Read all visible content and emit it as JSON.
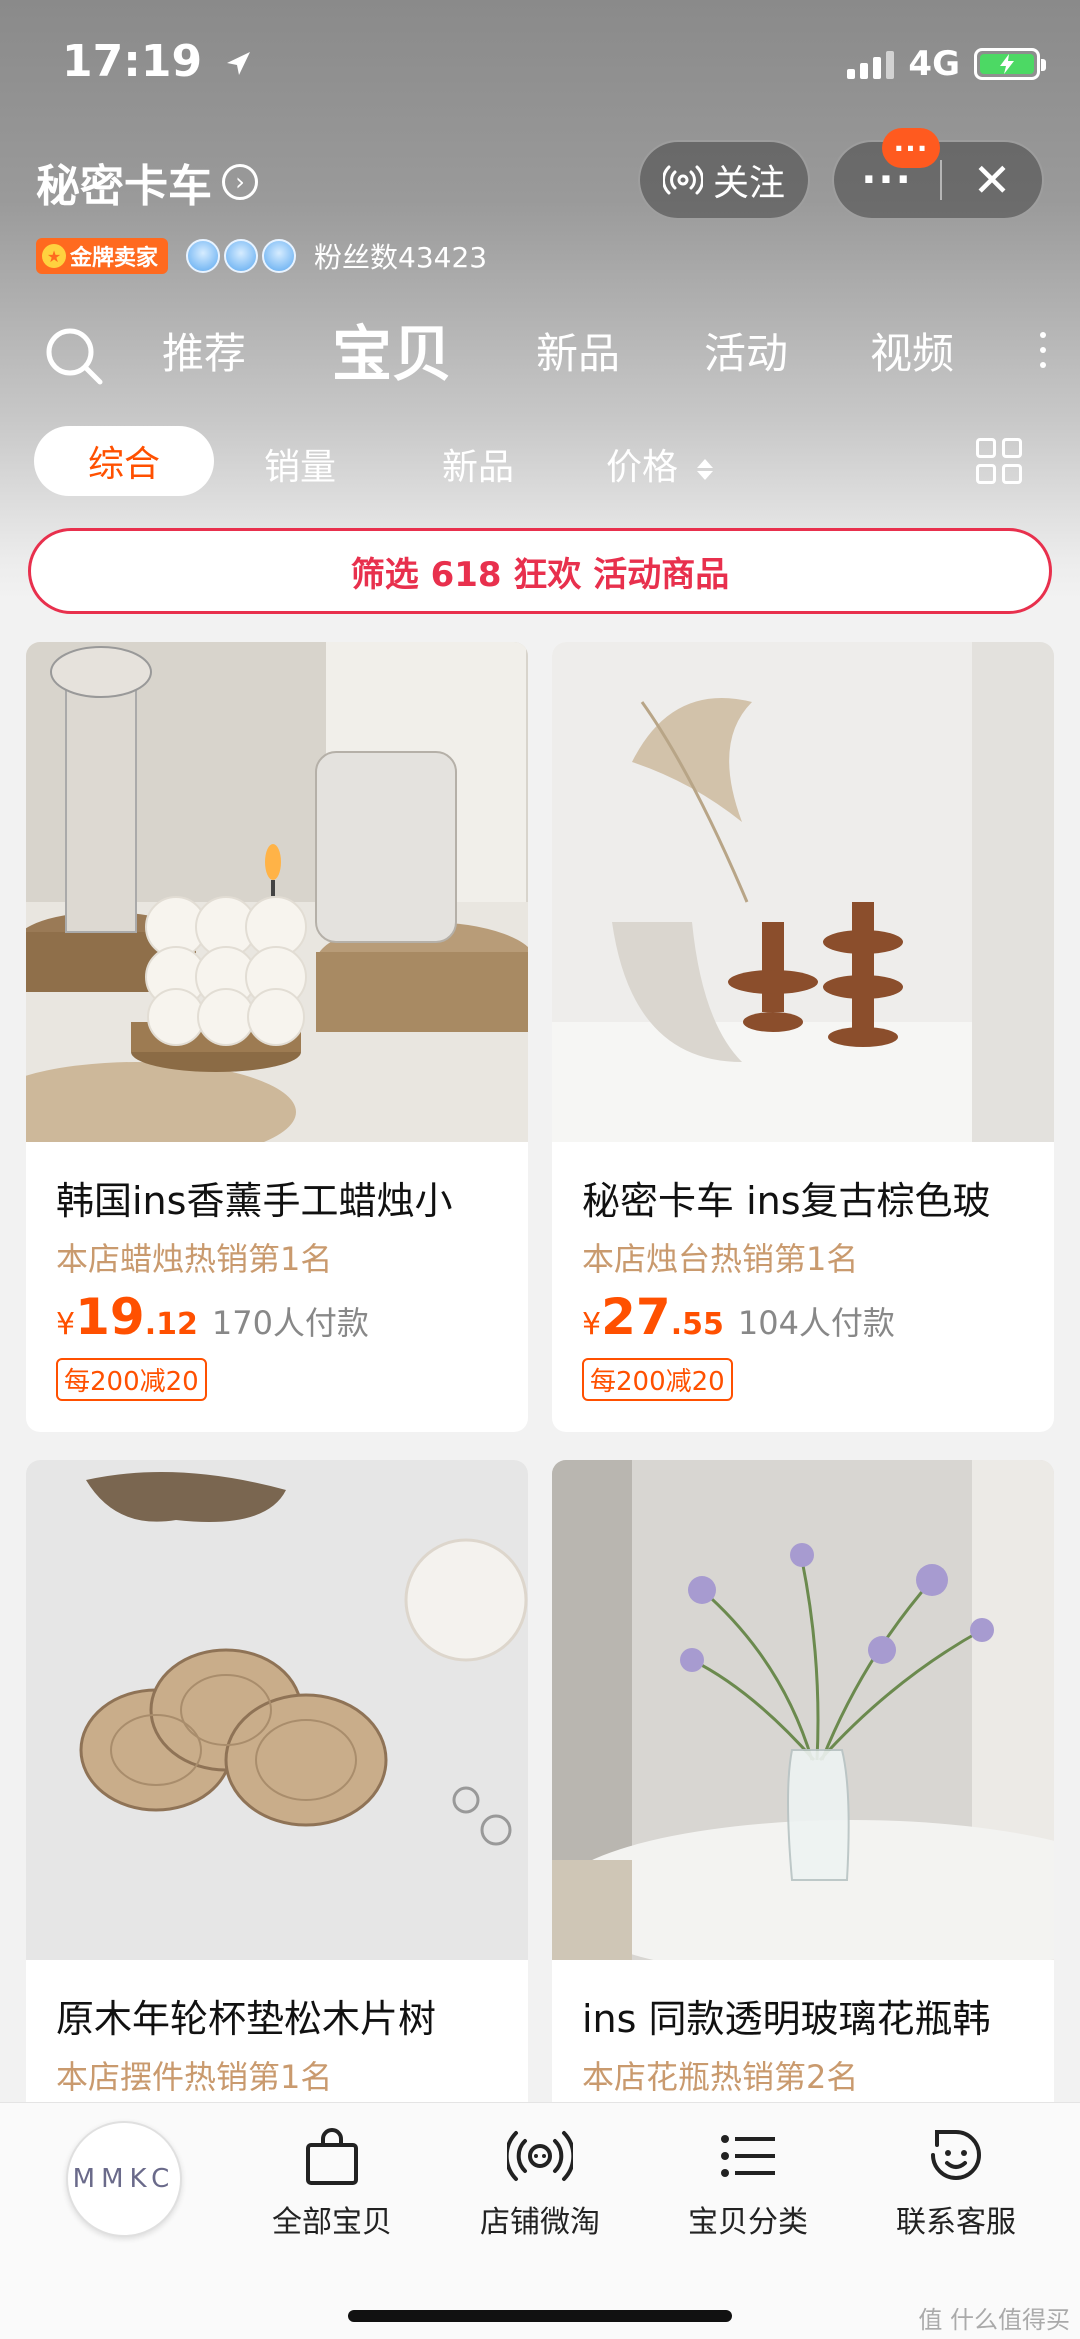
{
  "status_bar": {
    "time": "17:19",
    "network": "4G"
  },
  "shop": {
    "name": "秘密卡车",
    "follow_label": "关注",
    "badge_count": "···",
    "more_label": "···",
    "close_label": "✕",
    "seller_badge": "金牌卖家",
    "fans": "粉丝数43423"
  },
  "tabs": [
    {
      "label": "推荐"
    },
    {
      "label": "宝贝"
    },
    {
      "label": "新品"
    },
    {
      "label": "活动"
    },
    {
      "label": "视频"
    }
  ],
  "sort": {
    "items": [
      {
        "label": "综合"
      },
      {
        "label": "销量"
      },
      {
        "label": "新品"
      },
      {
        "label": "价格"
      }
    ]
  },
  "promo_filter": "筛选 618 狂欢 活动商品",
  "products": [
    {
      "title": "韩国ins香薰手工蜡烛小",
      "rank": "本店蜡烛热销第1名",
      "currency": "¥",
      "price_int": "19",
      "price_dec": ".12",
      "sold": "170人付款",
      "coupon": "每200减20"
    },
    {
      "title": "秘密卡车 ins复古棕色玻",
      "rank": "本店烛台热销第1名",
      "currency": "¥",
      "price_int": "27",
      "price_dec": ".55",
      "sold": "104人付款",
      "coupon": "每200减20"
    },
    {
      "title": "原木年轮杯垫松木片树",
      "rank": "本店摆件热销第1名"
    },
    {
      "title": "ins 同款透明玻璃花瓶韩",
      "rank": "本店花瓶热销第2名"
    }
  ],
  "bottom_nav": {
    "logo_text": "MMKC",
    "items": [
      {
        "label": "全部宝贝",
        "icon": "bag-icon"
      },
      {
        "label": "店铺微淘",
        "icon": "broadcast-icon"
      },
      {
        "label": "宝贝分类",
        "icon": "list-icon"
      },
      {
        "label": "联系客服",
        "icon": "service-icon"
      }
    ]
  },
  "watermark": "值 什么值得买",
  "colors": {
    "accent": "#ff5000",
    "promo": "#e8304d",
    "rank": "#c99a6e"
  }
}
